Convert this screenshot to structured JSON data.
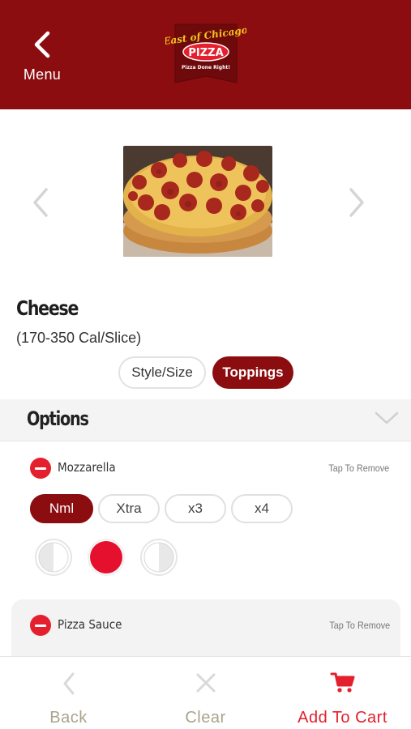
{
  "header": {
    "menu_label": "Menu",
    "logo_text_top": "East of Chicago",
    "logo_text_main": "PIZZA",
    "logo_tagline": "Pizza Done Right!"
  },
  "item": {
    "name": "Cheese",
    "calories": "(170-350 Cal/Slice)"
  },
  "tabs": [
    {
      "label": "Style/Size",
      "active": false
    },
    {
      "label": "Toppings",
      "active": true
    }
  ],
  "options": {
    "title": "Options"
  },
  "toppings": [
    {
      "name": "Mozzarella",
      "action": "Tap To Remove",
      "amounts": [
        "Nml",
        "Xtra",
        "x3",
        "x4"
      ],
      "selected_amount": "Nml",
      "coverage": [
        "left-half",
        "whole",
        "right-half"
      ],
      "selected_coverage": "whole"
    },
    {
      "name": "Pizza Sauce",
      "action": "Tap To Remove"
    }
  ],
  "bottom_bar": {
    "back_label": "Back",
    "clear_label": "Clear",
    "add_to_cart_label": "Add To Cart"
  },
  "colors": {
    "brand": "#8b0d10",
    "accent": "#e5202e",
    "muted_label": "#a9a48d"
  }
}
